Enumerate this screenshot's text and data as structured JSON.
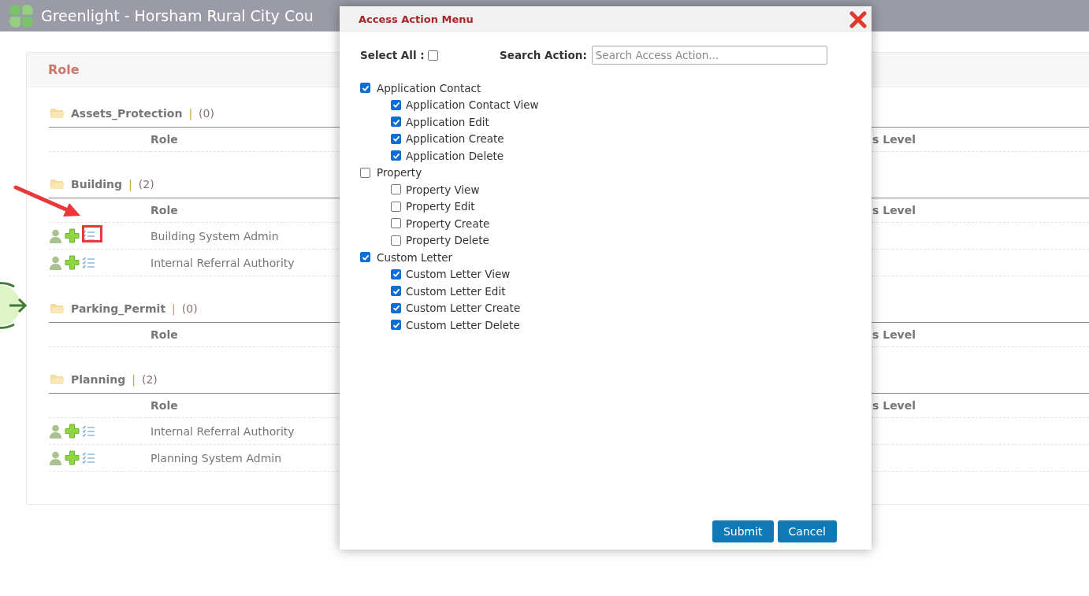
{
  "header": {
    "title": "Greenlight - Horsham Rural City Cou"
  },
  "panel": {
    "title": "Role",
    "groups": [
      {
        "name": "Assets_Protection",
        "separator": "|",
        "count": "(0)",
        "columns": [
          "Role",
          "s Level"
        ]
      },
      {
        "name": "Building",
        "separator": "|",
        "count": "(2)",
        "columns": [
          "Role",
          "s Level"
        ],
        "rows": [
          {
            "role": "Building System Admin",
            "annotated": true
          },
          {
            "role": "Internal Referral Authority",
            "annotated": false
          }
        ]
      },
      {
        "name": "Parking_Permit",
        "separator": "|",
        "count": "(0)",
        "columns": [
          "Role",
          "s Level"
        ]
      },
      {
        "name": "Planning",
        "separator": "|",
        "count": "(2)",
        "columns": [
          "Role",
          "s Level"
        ],
        "rows": [
          {
            "role": "Internal Referral Authority",
            "annotated": false
          },
          {
            "role": "Planning System Admin",
            "annotated": false
          }
        ]
      }
    ]
  },
  "modal": {
    "title": "Access Action Menu",
    "select_all": {
      "label": "Select All :",
      "checked": false
    },
    "search": {
      "label": "Search Action:",
      "placeholder": "Search Access Action..."
    },
    "groups": [
      {
        "label": "Application Contact",
        "checked": true,
        "children": [
          {
            "label": "Application Contact View",
            "checked": true
          },
          {
            "label": "Application Edit",
            "checked": true
          },
          {
            "label": "Application Create",
            "checked": true
          },
          {
            "label": "Application Delete",
            "checked": true
          }
        ]
      },
      {
        "label": "Property",
        "checked": false,
        "children": [
          {
            "label": "Property View",
            "checked": false
          },
          {
            "label": "Property Edit",
            "checked": false
          },
          {
            "label": "Property Create",
            "checked": false
          },
          {
            "label": "Property Delete",
            "checked": false
          }
        ]
      },
      {
        "label": "Custom Letter",
        "checked": true,
        "children": [
          {
            "label": "Custom Letter View",
            "checked": true
          },
          {
            "label": "Custom Letter Edit",
            "checked": true
          },
          {
            "label": "Custom Letter Create",
            "checked": true
          },
          {
            "label": "Custom Letter Delete",
            "checked": true
          }
        ]
      }
    ],
    "buttons": [
      "Submit",
      "Cancel"
    ]
  }
}
